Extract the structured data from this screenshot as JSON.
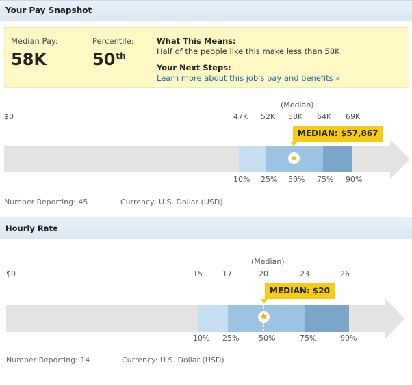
{
  "snapshot": {
    "title": "Your Pay Snapshot",
    "median_pay_label": "Median Pay:",
    "median_pay_value": "58K",
    "percentile_label": "Percentile:",
    "percentile_value": "50",
    "percentile_suffix": "th",
    "what_means_title": "What This Means:",
    "what_means_text": "Half of the people like this make less than 58K",
    "next_steps_title": "Your Next Steps:",
    "next_steps_link": "Learn more about this job's pay and benefits »"
  },
  "pay_chart": {
    "zero_label": "$0",
    "median_caption": "(Median)",
    "values": [
      "47K",
      "52K",
      "58K",
      "64K",
      "69K"
    ],
    "percentiles": [
      "10%",
      "25%",
      "50%",
      "75%",
      "90%"
    ],
    "callout": "MEDIAN: $57,867",
    "number_reporting": "Number Reporting: 45",
    "currency": "Currency: U.S. Dollar (USD)"
  },
  "hourly": {
    "title": "Hourly Rate",
    "zero_label": "$0",
    "median_caption": "(Median)",
    "values": [
      "15",
      "17",
      "20",
      "23",
      "26"
    ],
    "percentiles": [
      "10%",
      "25%",
      "50%",
      "75%",
      "90%"
    ],
    "callout": "MEDIAN: $20",
    "number_reporting": "Number Reporting: 14",
    "currency": "Currency: U.S. Dollar (USD)"
  },
  "colors": {
    "band_outer": "#c6dff0",
    "band_inner": "#9dc3e1",
    "band_upper": "#7ba5c9",
    "callout": "#f7cb15",
    "highlight": "#fdf8c4"
  }
}
